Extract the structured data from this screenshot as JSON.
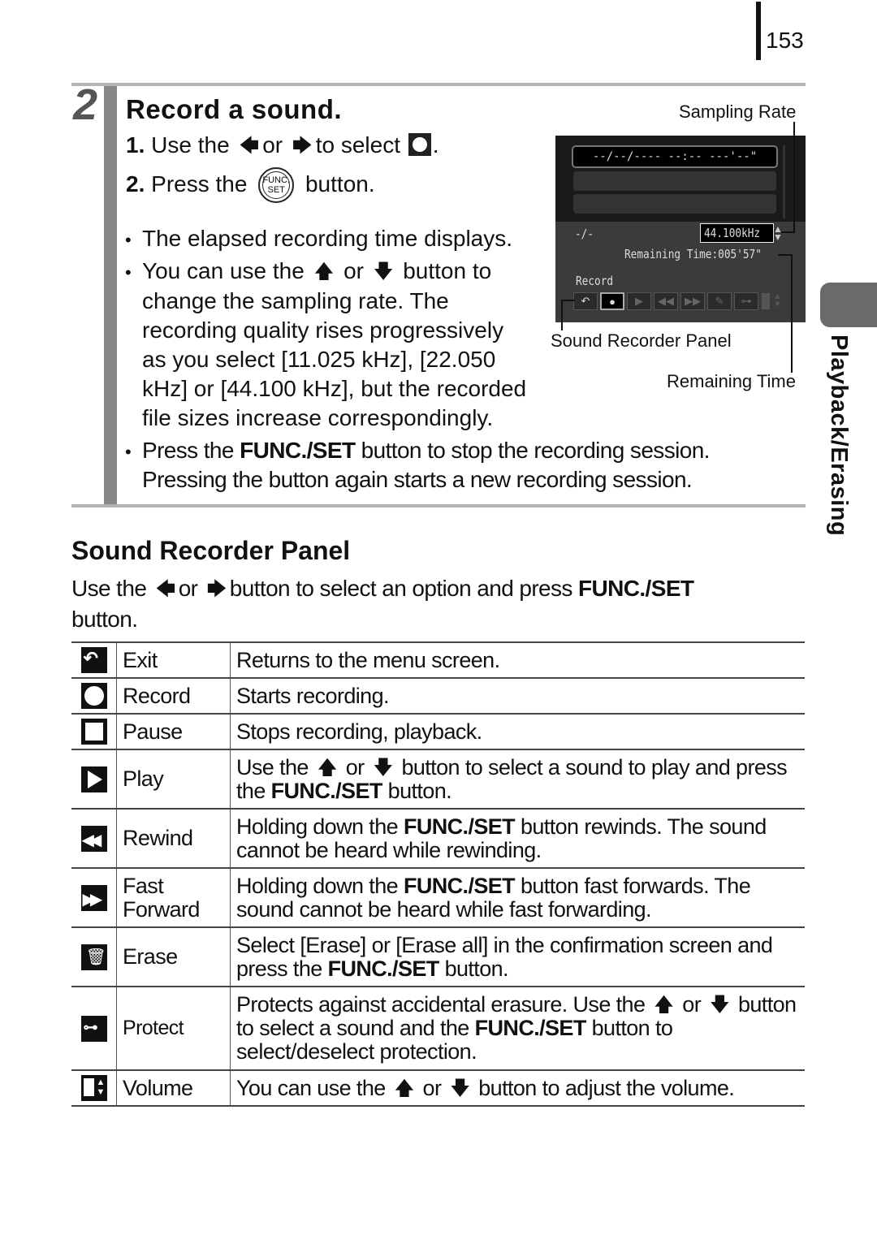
{
  "page_number": "153",
  "side_tab": "Playback/Erasing",
  "step": {
    "number": "2",
    "title": "Record a sound.",
    "instructions": [
      {
        "num": "1.",
        "pre": "Use the",
        "or": "or",
        "post": "to select",
        "end": "."
      },
      {
        "num": "2.",
        "pre": "Press the",
        "button_top": "FUNC.",
        "button_bottom": "SET",
        "post": "button."
      }
    ],
    "bullets": [
      "The elapsed recording time displays.",
      {
        "lines": [
          "You can use the",
          "or",
          "button to",
          "change the sampling rate. The",
          "recording quality rises progressively",
          "as you select [11.025 kHz], [22.050",
          "kHz] or [44.100 kHz], but the recorded",
          "file sizes increase correspondingly."
        ]
      },
      {
        "pre": "Press the",
        "bold": "FUNC./SET",
        "post": "button to stop the recording session.",
        "line2": "Pressing the button again starts a new recording session."
      }
    ]
  },
  "screen": {
    "date_row": "--/--/---- --:--  ---'--\"",
    "counter": "-/-",
    "rate": "44.100kHz",
    "remaining": "Remaining Time:005'57\"",
    "mode": "Record",
    "toolbar": [
      "exit",
      "record",
      "play",
      "rewind",
      "fast-forward",
      "erase",
      "protect",
      "volume"
    ],
    "selected": "record"
  },
  "callouts": {
    "sampling_rate": "Sampling Rate",
    "sound_recorder_panel": "Sound Recorder Panel",
    "remaining_time": "Remaining Time"
  },
  "section": {
    "title": "Sound Recorder Panel",
    "intro_pre": "Use the",
    "intro_or": "or",
    "intro_mid": "button to select an option and press",
    "intro_bold": "FUNC./SET",
    "intro_end": "button."
  },
  "table": [
    {
      "icon": "exit-icon",
      "name": "Exit",
      "desc": [
        {
          "t": "Returns to the menu screen."
        }
      ]
    },
    {
      "icon": "record-icon",
      "name": "Record",
      "desc": [
        {
          "t": "Starts recording."
        }
      ]
    },
    {
      "icon": "pause-icon",
      "name": "Pause",
      "desc": [
        {
          "t": "Stops recording, playback."
        }
      ]
    },
    {
      "icon": "play-icon",
      "name": "Play",
      "desc": [
        {
          "t": "Use the "
        },
        {
          "a": "up"
        },
        {
          "t": " or "
        },
        {
          "a": "down"
        },
        {
          "t": " button to select a sound to play and press the "
        },
        {
          "b": "FUNC./SET"
        },
        {
          "t": " button."
        }
      ]
    },
    {
      "icon": "rewind-icon",
      "name": "Rewind",
      "desc": [
        {
          "t": "Holding down the "
        },
        {
          "b": "FUNC./SET"
        },
        {
          "t": " button rewinds. The sound cannot be heard while rewinding."
        }
      ]
    },
    {
      "icon": "fast-forward-icon",
      "name": "Fast Forward",
      "desc": [
        {
          "t": "Holding down the "
        },
        {
          "b": "FUNC./SET"
        },
        {
          "t": " button fast forwards. The sound cannot be heard while fast forwarding."
        }
      ]
    },
    {
      "icon": "erase-icon",
      "name": "Erase",
      "desc": [
        {
          "t": "Select [Erase] or [Erase all] in the confirmation screen and press the "
        },
        {
          "b": "FUNC./SET"
        },
        {
          "t": " button."
        }
      ]
    },
    {
      "icon": "protect-icon",
      "name": "Protect",
      "desc": [
        {
          "t": "Protects against accidental erasure. Use the "
        },
        {
          "a": "up"
        },
        {
          "t": " or "
        },
        {
          "a": "down"
        },
        {
          "t": " button to select a sound and the "
        },
        {
          "b": "FUNC./SET"
        },
        {
          "t": " button to select/deselect protection."
        }
      ]
    },
    {
      "icon": "volume-icon",
      "name": "Volume",
      "desc": [
        {
          "t": "You can use the "
        },
        {
          "a": "up"
        },
        {
          "t": " or "
        },
        {
          "a": "down"
        },
        {
          "t": " button to adjust the volume."
        }
      ]
    }
  ]
}
